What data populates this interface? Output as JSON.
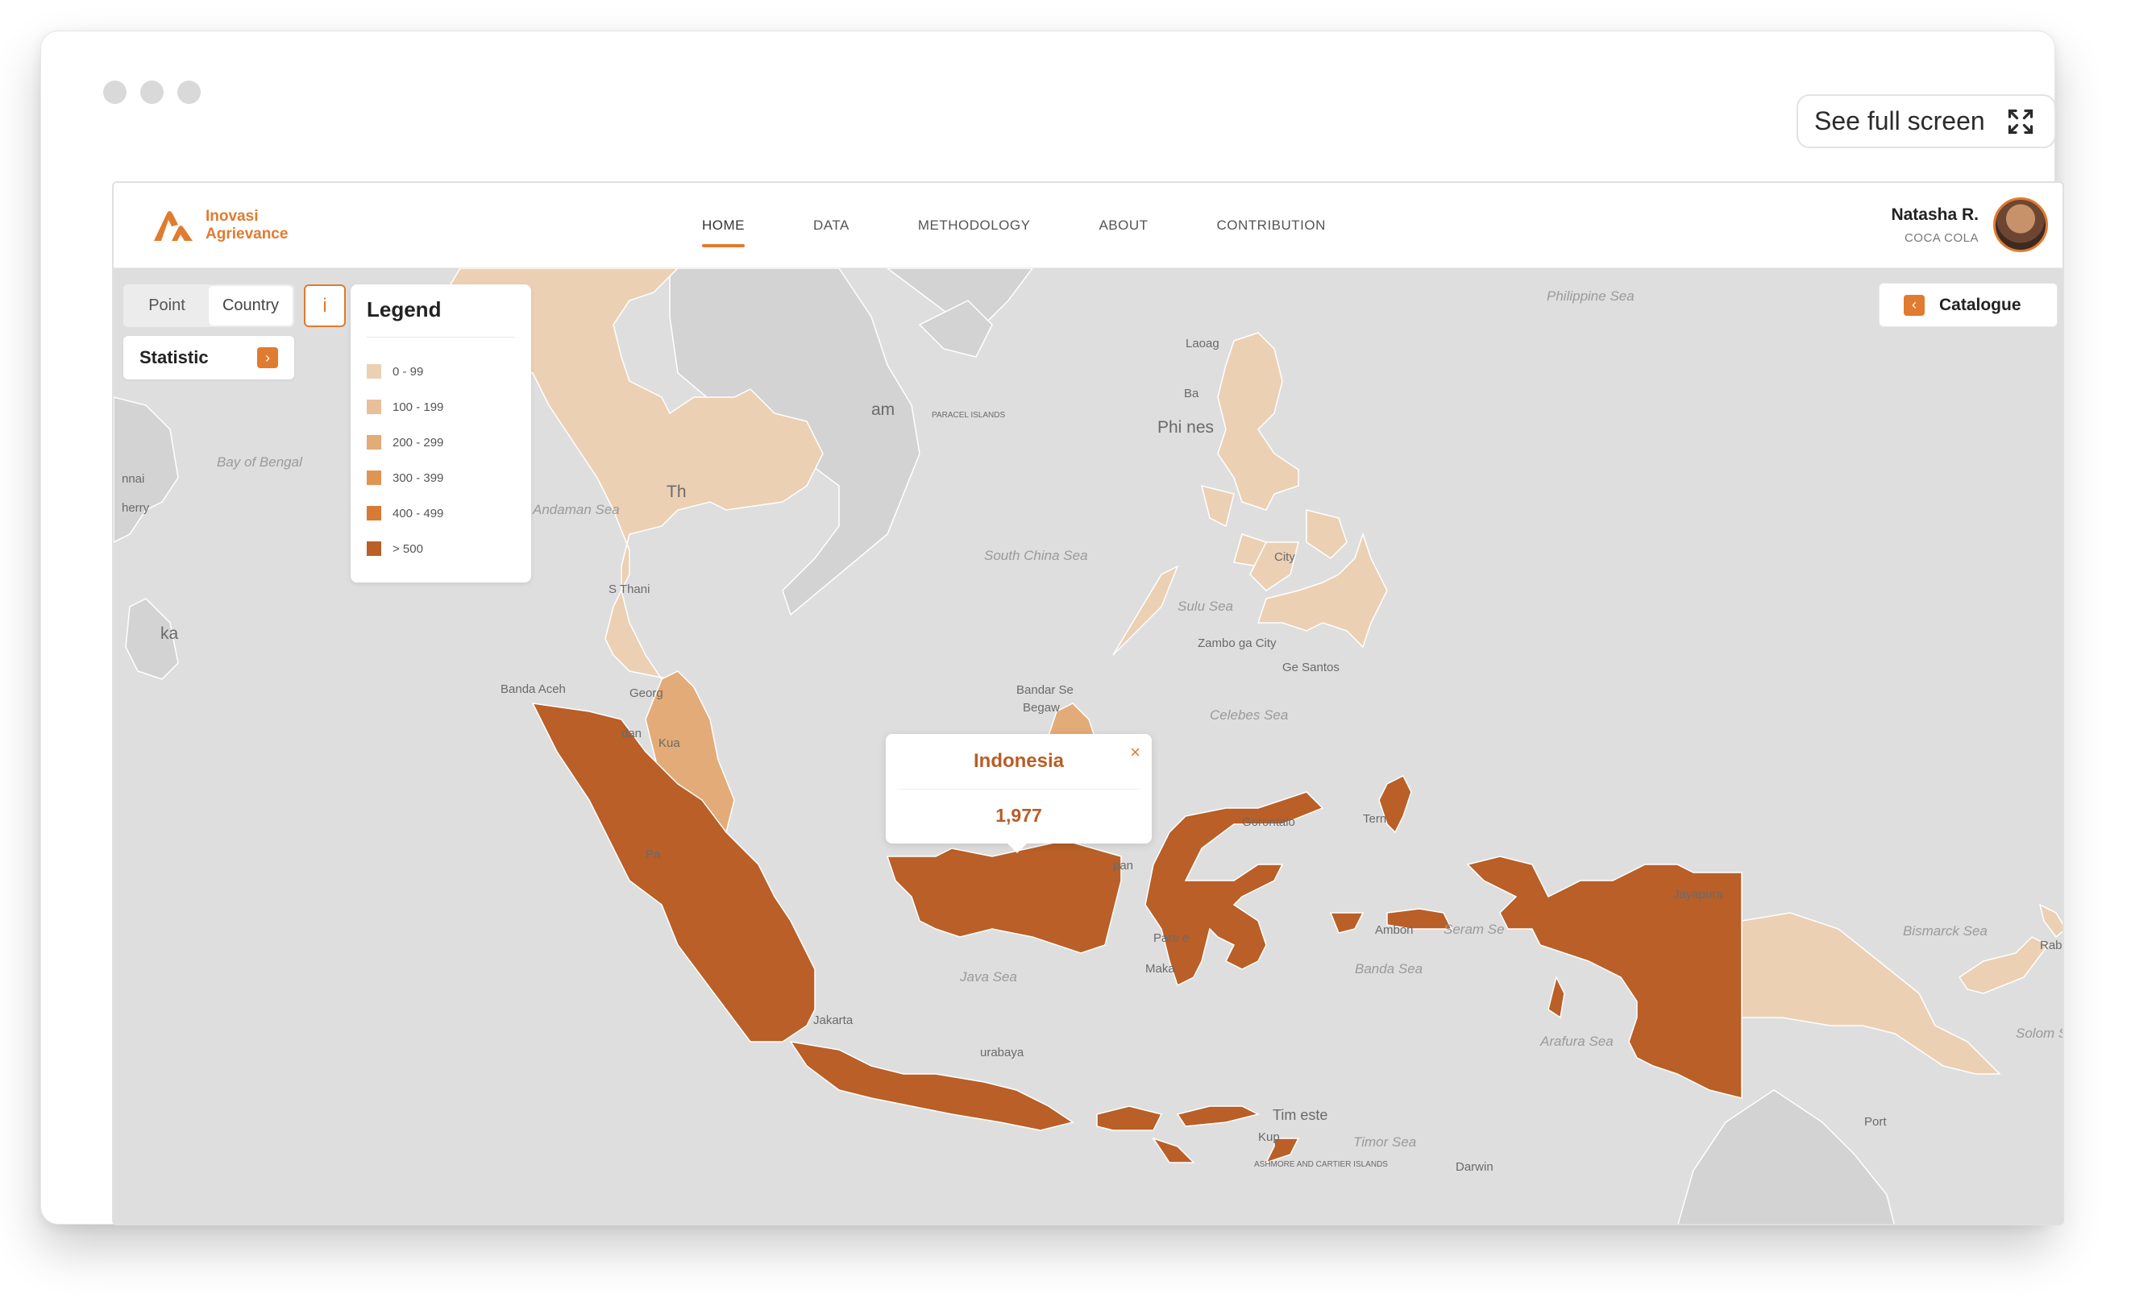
{
  "browser": {
    "fullscreen_label": "See full screen",
    "fullscreen_icon": "expand-icon"
  },
  "navbar": {
    "logo": {
      "line1": "Inovasi",
      "line2": "Agrievance",
      "icon": "logo-mark-icon"
    },
    "links": [
      {
        "label": "HOME",
        "active": true
      },
      {
        "label": "DATA",
        "active": false
      },
      {
        "label": "METHODOLOGY",
        "active": false
      },
      {
        "label": "ABOUT",
        "active": false
      },
      {
        "label": "CONTRIBUTION",
        "active": false
      }
    ],
    "user": {
      "name": "Natasha R.",
      "company": "COCA COLA"
    }
  },
  "controls": {
    "toggle": [
      {
        "label": "Point",
        "active": false
      },
      {
        "label": "Country",
        "active": true
      }
    ],
    "info_label": "i",
    "statistic_label": "Statistic",
    "catalogue_label": "Catalogue"
  },
  "legend": {
    "title": "Legend",
    "items": [
      {
        "label": "0 - 99",
        "color": "#ecd0b4"
      },
      {
        "label": "100 - 199",
        "color": "#e8bf98"
      },
      {
        "label": "200 - 299",
        "color": "#e3ab78"
      },
      {
        "label": "300 - 399",
        "color": "#de9552"
      },
      {
        "label": "400 - 499",
        "color": "#d67a36"
      },
      {
        "label": "> 500",
        "color": "#b95f27"
      }
    ]
  },
  "popup": {
    "country": "Indonesia",
    "value": "1,977",
    "close": "×"
  },
  "map_labels": {
    "philippine_sea": "Philippine Sea",
    "bay_of_bengal": "Bay of Bengal",
    "andaman_sea": "Andaman Sea",
    "south_china_sea": "South China Sea",
    "sulu_sea": "Sulu Sea",
    "celebes_sea": "Celebes Sea",
    "java_sea": "Java Sea",
    "banda_sea": "Banda Sea",
    "arafura_sea": "Arafura Sea",
    "timor_sea": "Timor Sea",
    "bismarck_sea": "Bismarck Sea",
    "solomon_sea": "Solom Sea",
    "paracel": "PARACEL ISLANDS",
    "ashmore": "ASHMORE AND CARTIER ISLANDS",
    "philippines": "Phi      nes",
    "thailand": "Th",
    "vietnam": "am",
    "srilanka": "ka",
    "chennai": "nnai",
    "cherry": "herry",
    "laoag": "Laoag",
    "ba": "Ba",
    "city": "City",
    "zamboanga": "Zambo  ga City",
    "gensantos": "Ge    Santos",
    "surat_thani": "S  Thani",
    "banda_aceh": "Banda Aceh",
    "george": "Georg",
    "kuala": "Kua",
    "medan": "dan",
    "pa": "Pa",
    "bandar": "Bandar Se",
    "begaw": "Begaw",
    "jakarta": "Jakarta",
    "surabaya": "urabaya",
    "pan": "pan",
    "pare": "Pare   e",
    "maka": "Maka",
    "gorontalo": "Gorontalo",
    "ternate": "Tern",
    "ambon": "Ambon",
    "seram": "Seram Se",
    "jayapura": "Jayapura",
    "timor_leste": "Tim    este",
    "kupang": "Kup",
    "darwin": "Darwin",
    "port": "Port",
    "rabaul": "Raba"
  }
}
